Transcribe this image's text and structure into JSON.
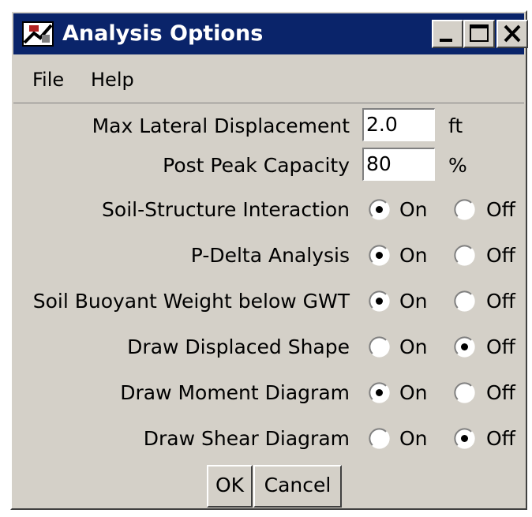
{
  "window": {
    "title": "Analysis Options",
    "colors": {
      "titlebar": "#0a246a",
      "face": "#d4d0c8",
      "title_text": "#ffffff"
    },
    "icons": [
      "app-icon",
      "minimize-icon",
      "maximize-icon",
      "close-icon"
    ]
  },
  "menu": {
    "items": [
      {
        "label": "File"
      },
      {
        "label": "Help"
      }
    ]
  },
  "fields": [
    {
      "label": "Max Lateral Displacement",
      "value": "2.0",
      "unit": "ft"
    },
    {
      "label": "Post Peak Capacity",
      "value": "80",
      "unit": "%"
    }
  ],
  "options": [
    {
      "label": "Soil-Structure Interaction",
      "on": "On",
      "off": "Off",
      "selected": "on"
    },
    {
      "label": "P-Delta Analysis",
      "on": "On",
      "off": "Off",
      "selected": "on"
    },
    {
      "label": "Soil Buoyant Weight below GWT",
      "on": "On",
      "off": "Off",
      "selected": "on"
    },
    {
      "label": "Draw Displaced Shape",
      "on": "On",
      "off": "Off",
      "selected": "off"
    },
    {
      "label": "Draw Moment Diagram",
      "on": "On",
      "off": "Off",
      "selected": "on"
    },
    {
      "label": "Draw Shear Diagram",
      "on": "On",
      "off": "Off",
      "selected": "off"
    }
  ],
  "buttons": {
    "ok": "OK",
    "cancel": "Cancel"
  }
}
